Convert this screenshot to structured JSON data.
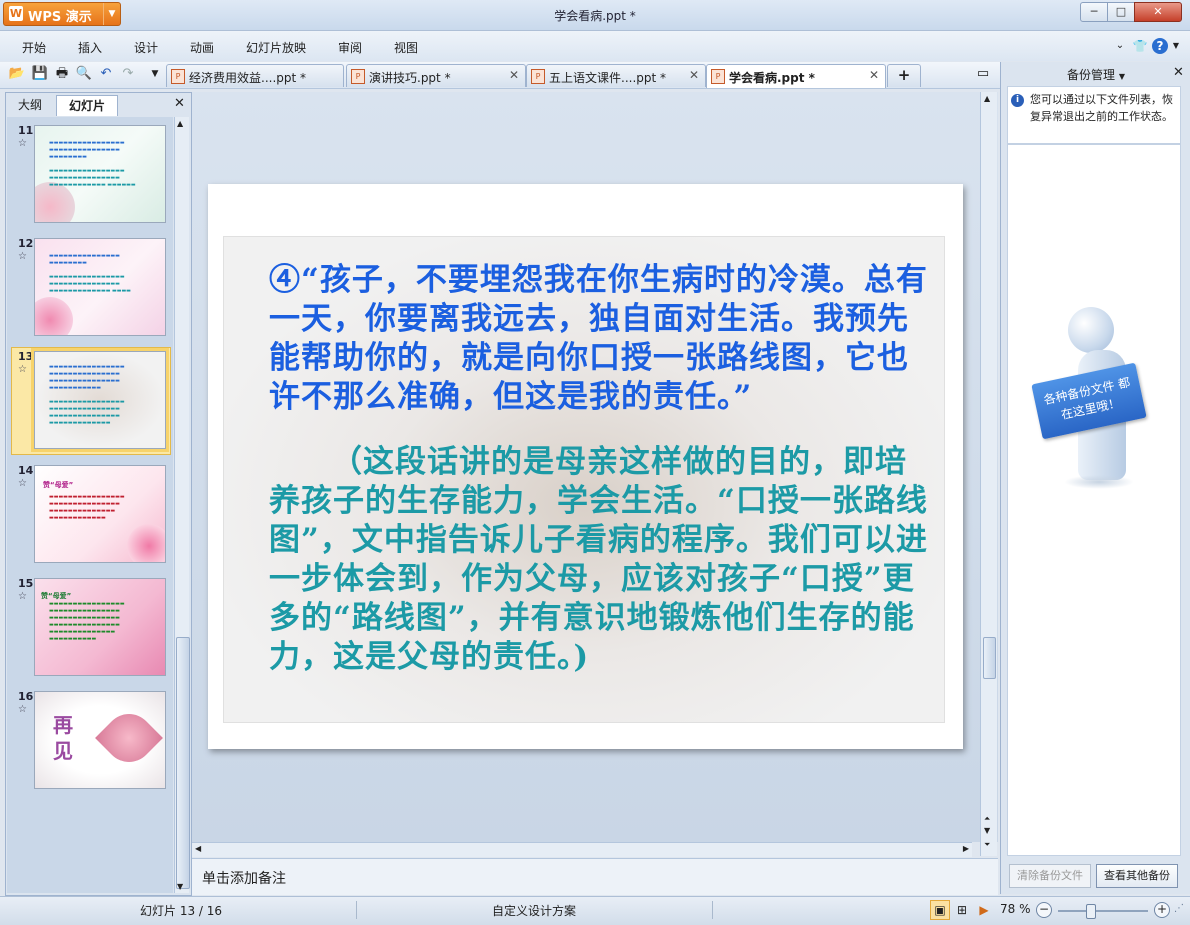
{
  "app": {
    "brand": "WPS 演示",
    "window_title": "学会看病.ppt *",
    "window_controls": {
      "minimize": "─",
      "maximize": "□",
      "close": "✕"
    }
  },
  "menu": {
    "items": [
      "开始",
      "插入",
      "设计",
      "动画",
      "幻灯片放映",
      "审阅",
      "视图"
    ],
    "right_icons": [
      "chevron-down-icon",
      "shirt-skin-icon",
      "help-icon"
    ]
  },
  "toolbar": {
    "icons": [
      "open-folder-icon",
      "save-icon",
      "print-icon",
      "print-preview-icon",
      "undo-icon",
      "redo-icon",
      "customize-dropdown-icon"
    ]
  },
  "tabs": [
    {
      "label": "经济费用效益....ppt *",
      "active": false
    },
    {
      "label": "演讲技巧.ppt *",
      "active": false
    },
    {
      "label": "五上语文课件....ppt *",
      "active": false
    },
    {
      "label": "学会看病.ppt *",
      "active": true
    }
  ],
  "new_tab": "+",
  "left_panel": {
    "tab_outline": "大纲",
    "tab_slides": "幻灯片",
    "close": "✕",
    "thumbnails": [
      {
        "number": "11",
        "star": "☆",
        "selected": false
      },
      {
        "number": "12",
        "star": "☆",
        "selected": false
      },
      {
        "number": "13",
        "star": "☆",
        "selected": true
      },
      {
        "number": "14",
        "star": "☆",
        "selected": false,
        "title": "赞“母爱”"
      },
      {
        "number": "15",
        "star": "☆",
        "selected": false,
        "title": "赞“母爱”"
      },
      {
        "number": "16",
        "star": "☆",
        "selected": false,
        "title": "再见"
      }
    ]
  },
  "slide": {
    "paragraph1": "④“孩子，不要埋怨我在你生病时的冷漠。总有一天，你要离我远去，独自面对生活。我预先能帮助你的，就是向你口授一张路线图，它也许不那么准确，但这是我的责任。”",
    "paragraph2": "（这段话讲的是母亲这样做的目的，即培养孩子的生存能力，学会生活。“口授一张路线图”，文中指告诉儿子看病的程序。我们可以进一步体会到，作为父母，应该对孩子“口授”更多的“路线图”，并有意识地锻炼他们生存的能力，这是父母的责任。)",
    "colors": {
      "paragraph1": "#1b5fe0",
      "paragraph2": "#1c9aa6"
    }
  },
  "notes": {
    "placeholder": "单击添加备注"
  },
  "right_panel": {
    "title": "备份管理",
    "close": "✕",
    "info": "您可以通过以下文件列表，恢复异常退出之前的工作状态。",
    "sign_text": "各种备份文件 都在这里哦！",
    "btn_clear": "清除备份文件",
    "btn_view_more": "查看其他备份"
  },
  "status": {
    "slide_counter": "幻灯片 13 / 16",
    "design": "自定义设计方案",
    "zoom": "78 %"
  }
}
